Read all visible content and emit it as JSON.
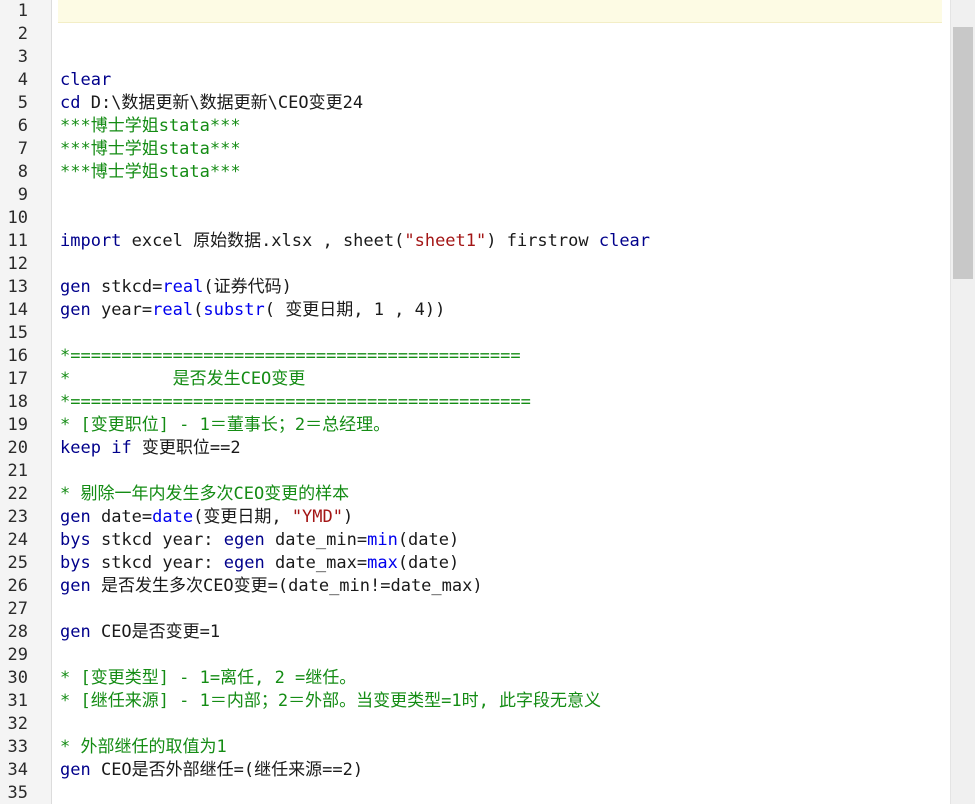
{
  "editor": {
    "line_numbers": [
      "1",
      "2",
      "3",
      "4",
      "5",
      "6",
      "7",
      "8",
      "9",
      "10",
      "11",
      "12",
      "13",
      "14",
      "15",
      "16",
      "17",
      "18",
      "19",
      "20",
      "21",
      "22",
      "23",
      "24",
      "25",
      "26",
      "27",
      "28",
      "29",
      "30",
      "31",
      "32",
      "33",
      "34",
      "35"
    ],
    "lines": [
      [],
      [],
      [],
      [
        {
          "t": "clear",
          "c": "kw"
        }
      ],
      [
        {
          "t": "cd",
          "c": "kw"
        },
        {
          "t": " D:\\数据更新\\数据更新\\CEO变更24",
          "c": "pl"
        }
      ],
      [
        {
          "t": "***博士学姐stata***",
          "c": "cm"
        }
      ],
      [
        {
          "t": "***博士学姐stata***",
          "c": "cm"
        }
      ],
      [
        {
          "t": "***博士学姐stata***",
          "c": "cm"
        }
      ],
      [],
      [],
      [
        {
          "t": "import",
          "c": "kw"
        },
        {
          "t": " excel 原始数据.xlsx , sheet(",
          "c": "pl"
        },
        {
          "t": "\"sheet1\"",
          "c": "str"
        },
        {
          "t": ") firstrow ",
          "c": "pl"
        },
        {
          "t": "clear",
          "c": "kw"
        }
      ],
      [],
      [
        {
          "t": "gen",
          "c": "kw"
        },
        {
          "t": " stkcd=",
          "c": "pl"
        },
        {
          "t": "real",
          "c": "fn"
        },
        {
          "t": "(证券代码)",
          "c": "pl"
        }
      ],
      [
        {
          "t": "gen",
          "c": "kw"
        },
        {
          "t": " year=",
          "c": "pl"
        },
        {
          "t": "real",
          "c": "fn"
        },
        {
          "t": "(",
          "c": "pl"
        },
        {
          "t": "substr",
          "c": "fn"
        },
        {
          "t": "( 变更日期, 1 , 4))",
          "c": "pl"
        }
      ],
      [],
      [
        {
          "t": "*============================================",
          "c": "cm"
        }
      ],
      [
        {
          "t": "*          是否发生CEO变更",
          "c": "cm"
        }
      ],
      [
        {
          "t": "*=============================================",
          "c": "cm"
        }
      ],
      [
        {
          "t": "* [变更职位] - 1＝董事长；2＝总经理。",
          "c": "cm"
        }
      ],
      [
        {
          "t": "keep",
          "c": "kw"
        },
        {
          "t": " ",
          "c": "pl"
        },
        {
          "t": "if",
          "c": "kw"
        },
        {
          "t": " 变更职位==2",
          "c": "pl"
        }
      ],
      [],
      [
        {
          "t": "* 剔除一年内发生多次CEO变更的样本",
          "c": "cm"
        }
      ],
      [
        {
          "t": "gen",
          "c": "kw"
        },
        {
          "t": " date=",
          "c": "pl"
        },
        {
          "t": "date",
          "c": "fn"
        },
        {
          "t": "(变更日期, ",
          "c": "pl"
        },
        {
          "t": "\"YMD\"",
          "c": "str"
        },
        {
          "t": ")",
          "c": "pl"
        }
      ],
      [
        {
          "t": "bys",
          "c": "kw"
        },
        {
          "t": " stkcd year: ",
          "c": "pl"
        },
        {
          "t": "egen",
          "c": "kw"
        },
        {
          "t": " date_min=",
          "c": "pl"
        },
        {
          "t": "min",
          "c": "fn"
        },
        {
          "t": "(date)",
          "c": "pl"
        }
      ],
      [
        {
          "t": "bys",
          "c": "kw"
        },
        {
          "t": " stkcd year: ",
          "c": "pl"
        },
        {
          "t": "egen",
          "c": "kw"
        },
        {
          "t": " date_max=",
          "c": "pl"
        },
        {
          "t": "max",
          "c": "fn"
        },
        {
          "t": "(date)",
          "c": "pl"
        }
      ],
      [
        {
          "t": "gen",
          "c": "kw"
        },
        {
          "t": " 是否发生多次CEO变更=(date_min!=date_max)",
          "c": "pl"
        }
      ],
      [],
      [
        {
          "t": "gen",
          "c": "kw"
        },
        {
          "t": " CEO是否变更=1",
          "c": "pl"
        }
      ],
      [],
      [
        {
          "t": "* [变更类型] - 1=离任, 2 =继任。",
          "c": "cm"
        }
      ],
      [
        {
          "t": "* [继任来源] - 1＝内部；2＝外部。当变更类型=1时, 此字段无意义",
          "c": "cm"
        }
      ],
      [],
      [
        {
          "t": "* 外部继任的取值为1",
          "c": "cm"
        }
      ],
      [
        {
          "t": "gen",
          "c": "kw"
        },
        {
          "t": " CEO是否外部继任=(继任来源==2)",
          "c": "pl"
        }
      ],
      []
    ],
    "colors": {
      "keyword": "#00008b",
      "function": "#0000ee",
      "string": "#a31515",
      "comment": "#148c14",
      "plain": "#1a1a1a",
      "current_line_bg": "#fdfbe4",
      "gutter_bg": "#f4f4f4"
    }
  }
}
